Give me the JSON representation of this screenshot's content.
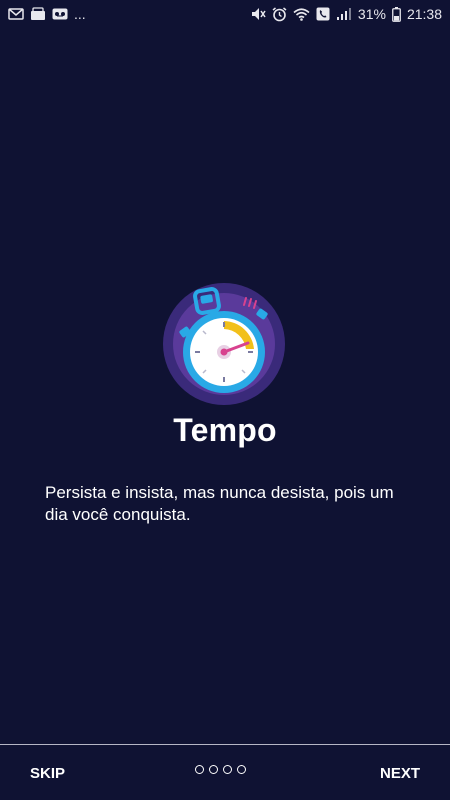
{
  "status_bar": {
    "left_icons": [
      "mail-icon",
      "wallet-icon",
      "voicemail-icon"
    ],
    "more": "...",
    "right_icons": [
      "mute-icon",
      "alarm-icon",
      "wifi-icon",
      "phone-icon",
      "signal-icon",
      "battery-icon"
    ],
    "battery": "31%",
    "time": "21:38"
  },
  "onboarding": {
    "icon": "stopwatch-icon",
    "title": "Tempo",
    "description": "Persista e insista, mas nunca desista, pois um dia você conquista."
  },
  "navigation": {
    "skip_label": "SKIP",
    "next_label": "NEXT",
    "page_indicator": {
      "total": 4,
      "current": 1
    }
  },
  "colors": {
    "background": "#0f1233",
    "accent_blue": "#29a9e6",
    "accent_purple": "#5a3a9b",
    "accent_yellow": "#f2c01a",
    "accent_pink": "#d8428f"
  }
}
